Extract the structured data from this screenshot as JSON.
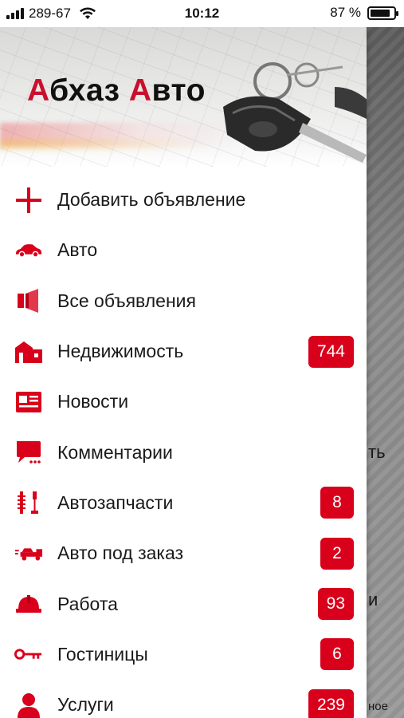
{
  "status_bar": {
    "carrier": "289-67",
    "time": "10:12",
    "battery": "87 %",
    "battery_level": 0.87
  },
  "header": {
    "logo_first_initial": "А",
    "logo_first_rest": "бхаз ",
    "logo_second_initial": "А",
    "logo_second_rest": "вто"
  },
  "menu": [
    {
      "label": "Добавить объявление",
      "icon": "plus-icon",
      "badge": null
    },
    {
      "label": "Авто",
      "icon": "car-icon",
      "badge": null
    },
    {
      "label": "Все объявления",
      "icon": "megaphone-icon",
      "badge": null
    },
    {
      "label": "Недвижимость",
      "icon": "buildings-icon",
      "badge": "744"
    },
    {
      "label": "Новости",
      "icon": "newspaper-icon",
      "badge": null
    },
    {
      "label": "Комментарии",
      "icon": "comment-icon",
      "badge": null
    },
    {
      "label": "Автозапчасти",
      "icon": "spare-parts-icon",
      "badge": "8"
    },
    {
      "label": "Авто под заказ",
      "icon": "car-transporter-icon",
      "badge": "2"
    },
    {
      "label": "Работа",
      "icon": "hard-hat-icon",
      "badge": "93"
    },
    {
      "label": "Гостиницы",
      "icon": "key-icon",
      "badge": "6"
    },
    {
      "label": "Услуги",
      "icon": "person-icon",
      "badge": "239"
    }
  ],
  "background_fragments": [
    "ть",
    "и",
    "ное"
  ],
  "colors": {
    "accent": "#d9001b",
    "logo_red": "#c8102e"
  }
}
